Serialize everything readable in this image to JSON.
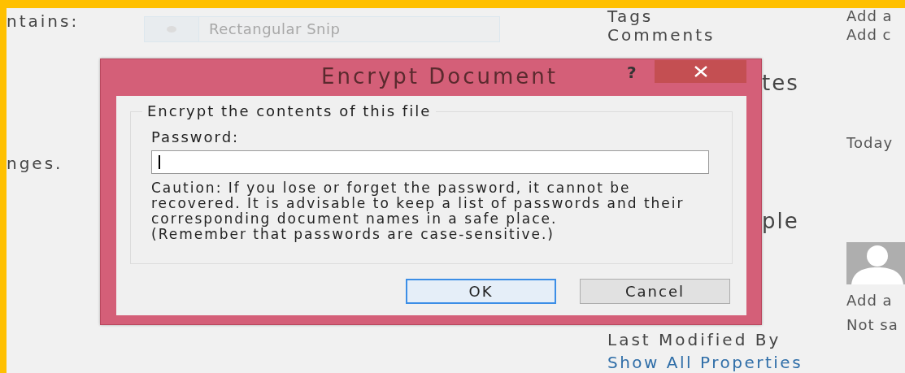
{
  "page": {
    "left_texts": [
      "ntains:",
      "nges."
    ],
    "snip_control": {
      "label": "Rectangular Snip",
      "disabled": true
    },
    "property_labels": [
      {
        "kind": "label",
        "text": "Tags"
      },
      {
        "kind": "label",
        "text": "Comments"
      },
      {
        "kind": "heading",
        "text": "tes"
      },
      {
        "kind": "heading",
        "text": "ple"
      },
      {
        "kind": "label",
        "text": "Last Modified By"
      },
      {
        "kind": "link",
        "text": "Show All Properties"
      }
    ],
    "property_values": [
      {
        "kind": "text",
        "text": "Add a"
      },
      {
        "kind": "text",
        "text": "Add c"
      },
      {
        "kind": "text",
        "text": "Today"
      },
      {
        "kind": "avatar"
      },
      {
        "kind": "text",
        "text": "Add a"
      },
      {
        "kind": "text",
        "text": "Not sa"
      }
    ]
  },
  "dialog": {
    "title": "Encrypt Document",
    "help": "?",
    "group_label": "Encrypt the contents of this file",
    "password_label": "Password:",
    "password_field": {
      "focused": true
    },
    "caution": "Caution: If you lose or forget the password, it cannot be recovered. It is advisable to keep a list of passwords and their corresponding document names in a safe place.",
    "note": "(Remember that passwords are case-sensitive.)",
    "buttons": [
      {
        "label": "OK",
        "default": true
      },
      {
        "label": "Cancel",
        "default": false
      }
    ]
  }
}
